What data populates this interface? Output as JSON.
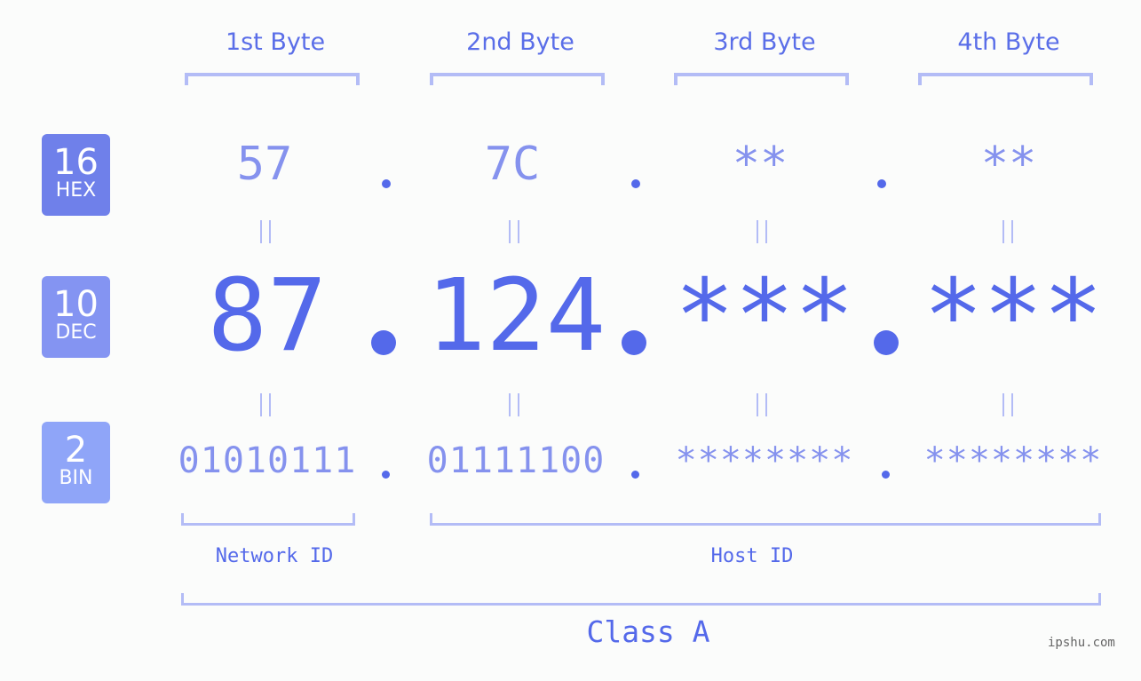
{
  "bytes": {
    "headers": [
      "1st Byte",
      "2nd Byte",
      "3rd Byte",
      "4th Byte"
    ]
  },
  "bases": {
    "hex": {
      "number": "16",
      "label": "HEX",
      "color": "#6f80ea"
    },
    "dec": {
      "number": "10",
      "label": "DEC",
      "color": "#8494f2"
    },
    "bin": {
      "number": "2",
      "label": "BIN",
      "color": "#8fa5f8"
    }
  },
  "values": {
    "hex": [
      "57",
      "7C",
      "**",
      "**"
    ],
    "dec": [
      "87",
      "124",
      "***",
      "***"
    ],
    "bin": [
      "01010111",
      "01111100",
      "********",
      "********"
    ]
  },
  "segments": {
    "network_id": "Network ID",
    "host_id": "Host ID",
    "class": "Class A"
  },
  "colors": {
    "primary": "#5469ea",
    "secondary": "#8592ee",
    "bracket": "#b3bcf6",
    "background": "#fbfcfb"
  },
  "watermark": "ipshu.com"
}
